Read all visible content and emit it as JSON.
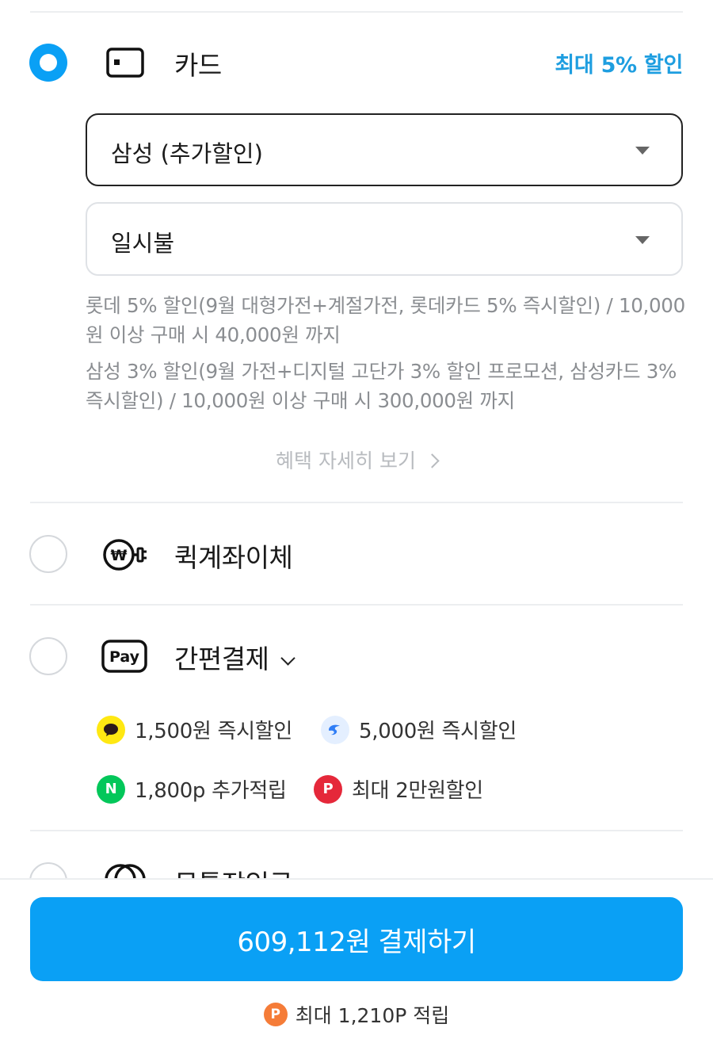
{
  "payment_methods": {
    "card": {
      "label": "카드",
      "discount": "최대 5% 할인",
      "issuer_select": {
        "value": "삼성 (추가할인)"
      },
      "installment_select": {
        "value": "일시불"
      },
      "promotions": [
        "롯데 5% 할인(9월 대형가전+계절가전, 롯데카드 5% 즉시할인) / 10,000원 이상 구매 시 40,000원 까지",
        "삼성 3% 할인(9월 가전+디지털 고단가 3% 할인 프로모션, 삼성카드 3% 즉시할인) / 10,000원 이상 구매 시 300,000원 까지"
      ],
      "benefit_link": "혜택 자세히 보기"
    },
    "quick_transfer": {
      "label": "퀵계좌이체"
    },
    "easy_pay": {
      "label": "간편결제",
      "icon_text": "Pay",
      "promos": [
        {
          "icon": "kakaopay-icon",
          "text": "1,500원 즉시할인",
          "color": "#ffe812"
        },
        {
          "icon": "tosspay-icon",
          "text": "5,000원 즉시할인",
          "color": "#e4efff"
        },
        {
          "icon": "naverpay-icon",
          "text": "1,800p 추가적립",
          "color": "#03c75a",
          "mark": "N"
        },
        {
          "icon": "payco-icon",
          "text": "최대 2만원할인",
          "color": "#e5283a",
          "mark": "P"
        }
      ]
    },
    "partial": {
      "label": "무통장입금"
    }
  },
  "checkout": {
    "pay_button": "609,112원 결제하기",
    "points_mark": "P",
    "points_text": "최대 1,210P 적립"
  }
}
